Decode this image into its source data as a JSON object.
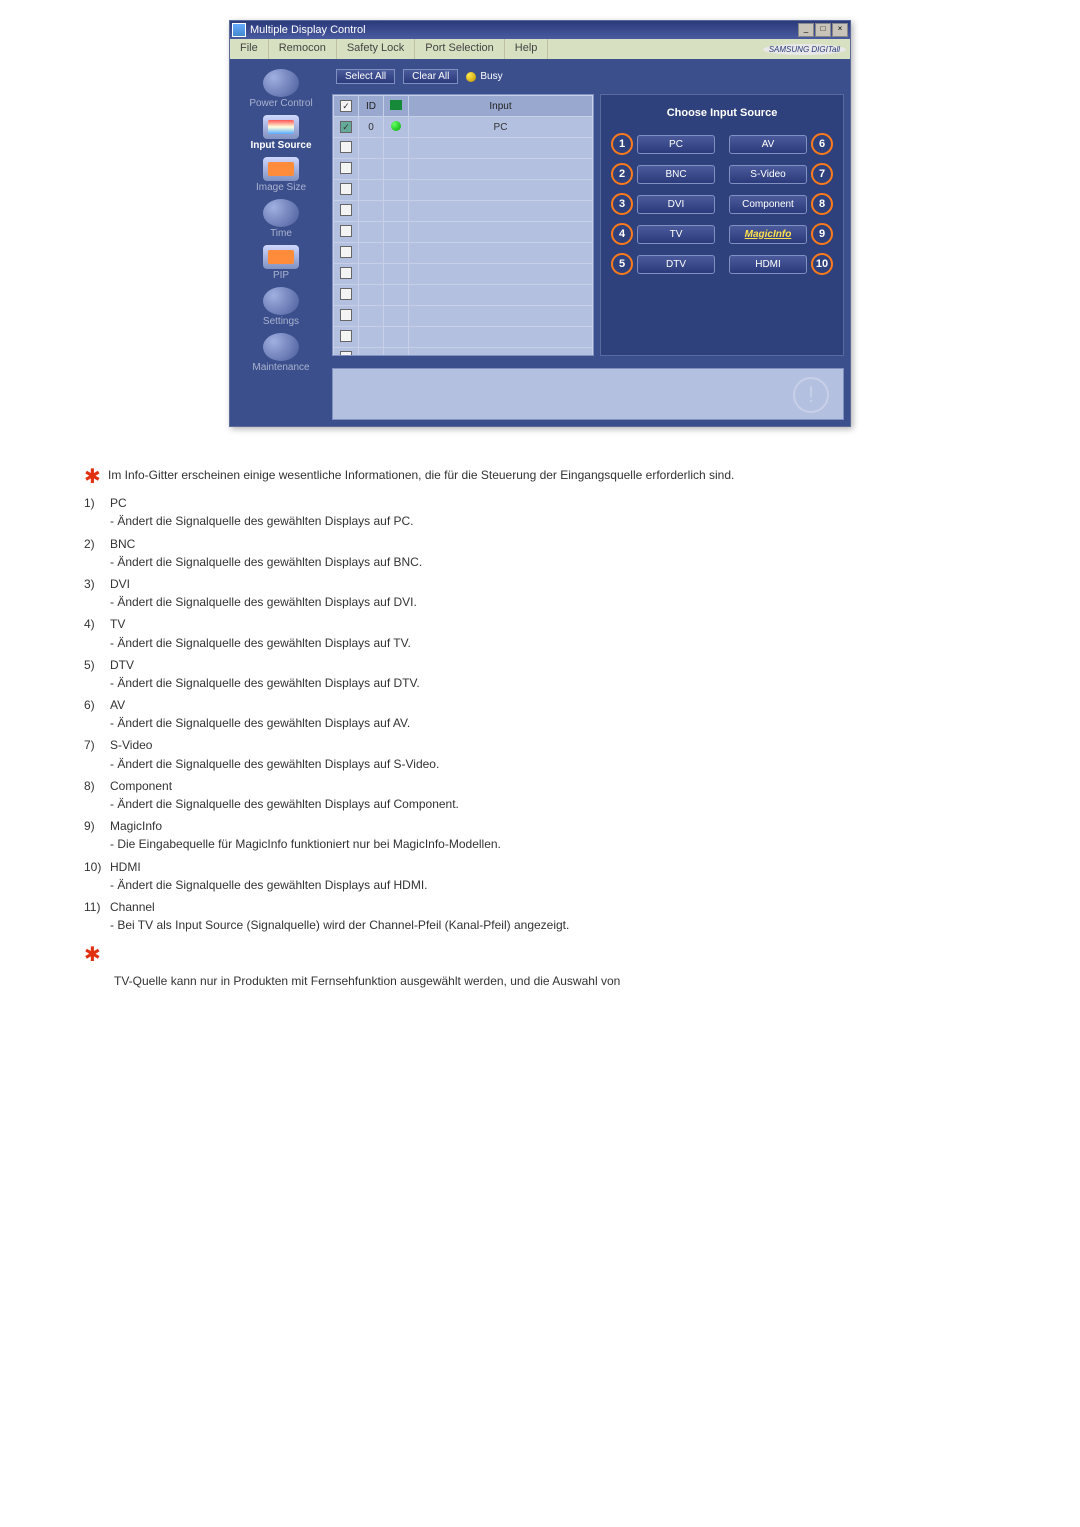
{
  "app": {
    "title": "Multiple Display Control",
    "menu": [
      "File",
      "Remocon",
      "Safety Lock",
      "Port Selection",
      "Help"
    ],
    "brand": "SAMSUNG DIGITall"
  },
  "toolbar": {
    "selectAll": "Select All",
    "clearAll": "Clear All",
    "busy": "Busy"
  },
  "sidebar": {
    "items": [
      {
        "label": "Power Control"
      },
      {
        "label": "Input Source"
      },
      {
        "label": "Image Size"
      },
      {
        "label": "Time"
      },
      {
        "label": "PIP"
      },
      {
        "label": "Settings"
      },
      {
        "label": "Maintenance"
      }
    ]
  },
  "grid": {
    "headers": {
      "id": "ID",
      "input": "Input"
    },
    "row0": {
      "id": "0",
      "input": "PC"
    }
  },
  "right": {
    "header": "Choose Input Source",
    "buttons": [
      {
        "num": "1",
        "label": "PC"
      },
      {
        "num": "6",
        "label": "AV"
      },
      {
        "num": "2",
        "label": "BNC"
      },
      {
        "num": "7",
        "label": "S-Video"
      },
      {
        "num": "3",
        "label": "DVI"
      },
      {
        "num": "8",
        "label": "Component"
      },
      {
        "num": "4",
        "label": "TV"
      },
      {
        "num": "9",
        "label": "MagicInfo"
      },
      {
        "num": "5",
        "label": "DTV"
      },
      {
        "num": "10",
        "label": "HDMI"
      }
    ]
  },
  "doc": {
    "intro": "Im Info-Gitter erscheinen einige wesentliche Informationen, die für die Steuerung der Eingangsquelle erforderlich sind.",
    "items": [
      {
        "n": "1)",
        "t": "PC",
        "d": "- Ändert die Signalquelle des gewählten Displays auf PC."
      },
      {
        "n": "2)",
        "t": "BNC",
        "d": "- Ändert die Signalquelle des gewählten Displays auf BNC."
      },
      {
        "n": "3)",
        "t": "DVI",
        "d": "- Ändert die Signalquelle des gewählten Displays auf DVI."
      },
      {
        "n": "4)",
        "t": "TV",
        "d": "- Ändert die Signalquelle des gewählten Displays auf TV."
      },
      {
        "n": "5)",
        "t": "DTV",
        "d": "- Ändert die Signalquelle des gewählten Displays auf DTV."
      },
      {
        "n": "6)",
        "t": "AV",
        "d": "- Ändert die Signalquelle des gewählten Displays auf AV."
      },
      {
        "n": "7)",
        "t": "S-Video",
        "d": "- Ändert die Signalquelle des gewählten Displays auf S-Video."
      },
      {
        "n": "8)",
        "t": "Component",
        "d": "- Ändert die Signalquelle des gewählten Displays auf Component."
      },
      {
        "n": "9)",
        "t": "MagicInfo",
        "d": "- Die Eingabequelle für MagicInfo funktioniert nur bei MagicInfo-Modellen."
      },
      {
        "n": "10)",
        "t": "HDMI",
        "d": "- Ändert die Signalquelle des gewählten Displays auf HDMI."
      },
      {
        "n": "11)",
        "t": "Channel",
        "d": "- Bei TV als Input Source (Signalquelle) wird der Channel-Pfeil (Kanal-Pfeil) angezeigt."
      }
    ],
    "footer": "TV-Quelle kann nur in Produkten mit Fernsehfunktion ausgewählt werden, und die Auswahl von"
  }
}
